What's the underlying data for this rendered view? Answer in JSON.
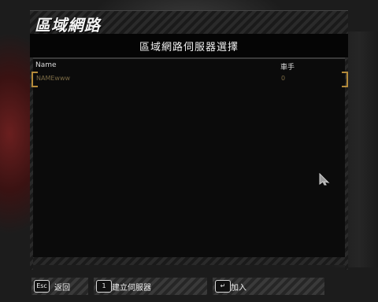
{
  "screen": {
    "title": "區域網路",
    "panel_heading": "區域網路伺服器選擇"
  },
  "server_list": {
    "columns": [
      "Name",
      "車手"
    ],
    "rows": [
      {
        "name": "NAMEwww",
        "drivers": "0"
      }
    ]
  },
  "footer": {
    "back": {
      "key": "Esc",
      "label": "返回"
    },
    "create": {
      "key": "1",
      "label": "建立伺服器"
    },
    "join": {
      "key": "↵",
      "label": "加入"
    }
  },
  "colors": {
    "accent_bracket": "#b38a3a",
    "row_text": "#7a6a45",
    "panel_bg": "#0b0b0b"
  },
  "icons": {
    "pointer": "arrow-cursor-icon",
    "enter_key": "enter-key-icon"
  }
}
